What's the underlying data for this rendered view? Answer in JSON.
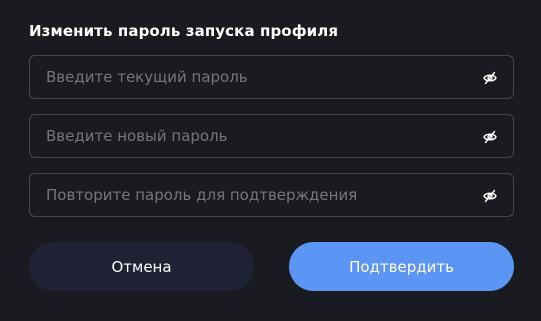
{
  "dialog": {
    "title": "Изменить пароль запуска профиля",
    "fields": [
      {
        "placeholder": "Введите текущий пароль",
        "value": "",
        "icon": "eye-off-icon"
      },
      {
        "placeholder": "Введите новый пароль",
        "value": "",
        "icon": "eye-off-icon"
      },
      {
        "placeholder": "Повторите пароль для подтверждения",
        "value": "",
        "icon": "eye-off-icon"
      }
    ],
    "buttons": {
      "cancel_label": "Отмена",
      "confirm_label": "Подтвердить"
    }
  },
  "colors": {
    "background": "#1a1b20",
    "field_border": "#46474d",
    "placeholder": "#75767c",
    "cancel_button": "#1e2234",
    "confirm_button": "#5b96f5",
    "text": "#ffffff"
  }
}
